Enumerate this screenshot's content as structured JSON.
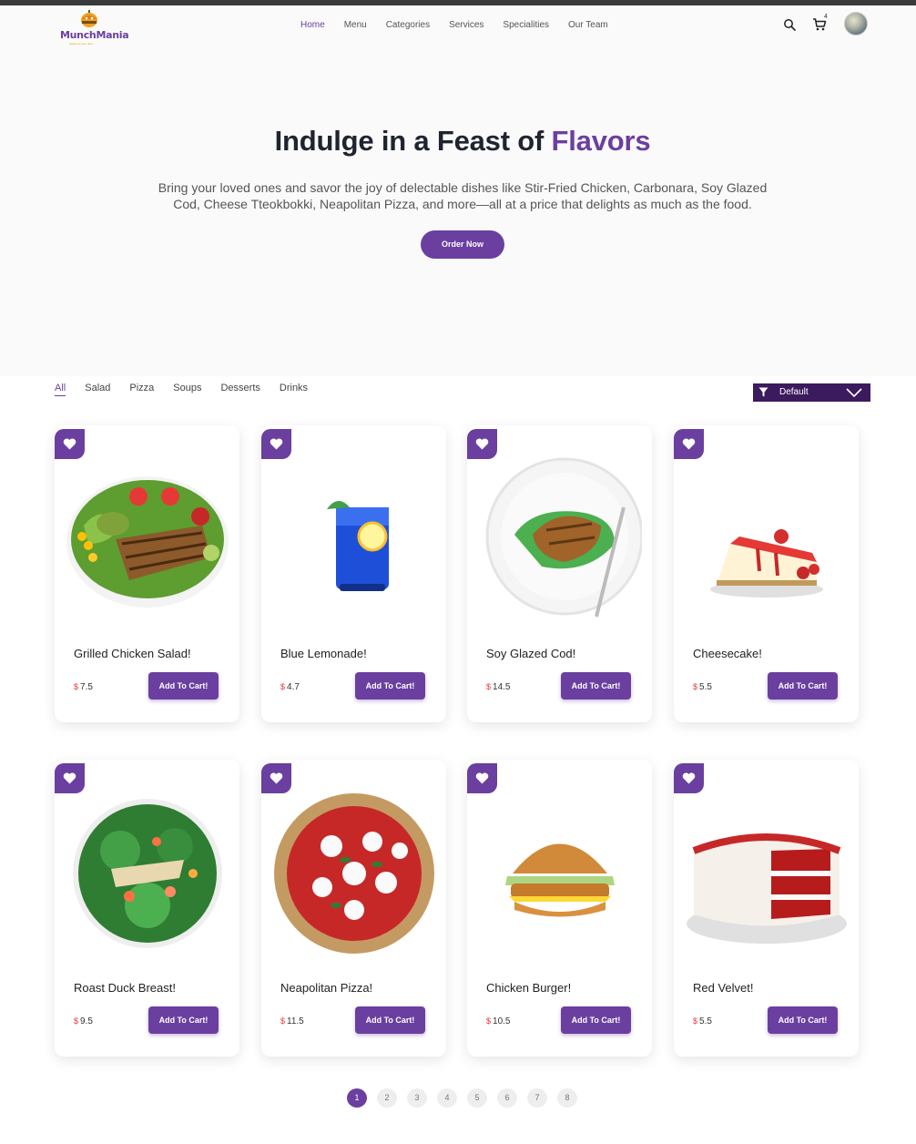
{
  "brand": {
    "name": "MunchMania",
    "tagline": "always at your door",
    "accent": "#6b3fa0",
    "dark_accent": "#3c1a5e",
    "price_color": "#e53935"
  },
  "nav": {
    "items": [
      {
        "label": "Home",
        "active": true
      },
      {
        "label": "Menu"
      },
      {
        "label": "Categories"
      },
      {
        "label": "Services"
      },
      {
        "label": "Specialities"
      },
      {
        "label": "Our Team"
      }
    ],
    "search_icon": "search-icon",
    "cart_icon": "cart-icon",
    "cart_count": "4"
  },
  "hero": {
    "title_main": "Indulge in a Feast of ",
    "title_accent": "Flavors",
    "description": "Bring your loved ones and savor the joy of delectable dishes like Stir-Fried Chicken, Carbonara, Soy Glazed Cod, Cheese Tteokbokki, Neapolitan Pizza, and more—all at a price that delights as much as the food.",
    "cta": "Order Now"
  },
  "filters": {
    "tabs": [
      "All",
      "Salad",
      "Pizza",
      "Soups",
      "Desserts",
      "Drinks"
    ],
    "active_tab": "All",
    "sort_label": "Default",
    "sort_icon": "funnel-icon"
  },
  "products": [
    {
      "name": "Grilled Chicken Salad!",
      "currency": "$",
      "price": "7.5",
      "button": "Add To Cart!",
      "image": "chicken-salad"
    },
    {
      "name": "Blue Lemonade!",
      "currency": "$",
      "price": "4.7",
      "button": "Add To Cart!",
      "image": "blue-lemonade"
    },
    {
      "name": "Soy Glazed Cod!",
      "currency": "$",
      "price": "14.5",
      "button": "Add To Cart!",
      "image": "glazed-cod"
    },
    {
      "name": "Cheesecake!",
      "currency": "$",
      "price": "5.5",
      "button": "Add To Cart!",
      "image": "cheesecake"
    },
    {
      "name": "Roast Duck Breast!",
      "currency": "$",
      "price": "9.5",
      "button": "Add To Cart!",
      "image": "duck-salad"
    },
    {
      "name": "Neapolitan Pizza!",
      "currency": "$",
      "price": "11.5",
      "button": "Add To Cart!",
      "image": "pizza"
    },
    {
      "name": "Chicken Burger!",
      "currency": "$",
      "price": "10.5",
      "button": "Add To Cart!",
      "image": "burger"
    },
    {
      "name": "Red Velvet!",
      "currency": "$",
      "price": "5.5",
      "button": "Add To Cart!",
      "image": "red-velvet"
    }
  ],
  "pagination": {
    "pages": [
      "1",
      "2",
      "3",
      "4",
      "5",
      "6",
      "7",
      "8"
    ],
    "current": "1"
  }
}
